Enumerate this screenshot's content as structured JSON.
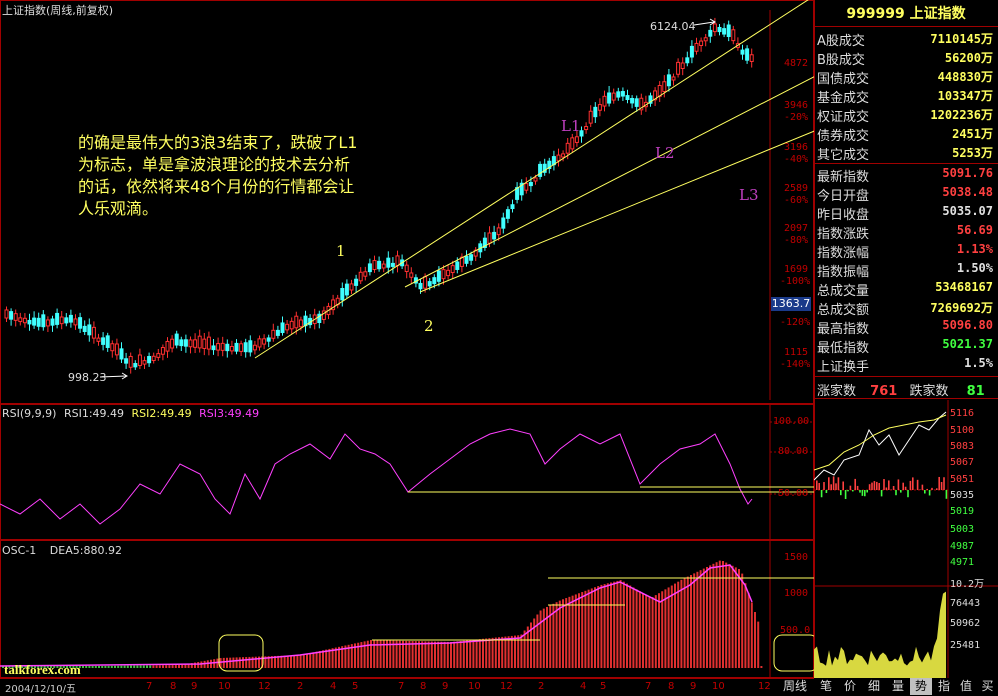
{
  "main_chart": {
    "title": "上证指数(周线,前复权)",
    "high_label": "6124.04",
    "low_label": "998.23",
    "current_price_box": "1363.7",
    "wave_labels": [
      "1",
      "2",
      "L1",
      "L2",
      "L3"
    ],
    "annotation": [
      "的确是最伟大的3浪3结束了，跌破了L1",
      "为标志，单是拿波浪理论的技术去分析",
      "的话，依然将来48个月份的行情都会让",
      "人乐观滴。"
    ],
    "y_axis": [
      {
        "label": "4872",
        "pct": ""
      },
      {
        "label": "3946",
        "pct": "-20%"
      },
      {
        "label": "3196",
        "pct": "-40%"
      },
      {
        "label": "2589",
        "pct": "-60%"
      },
      {
        "label": "2097",
        "pct": "-80%"
      },
      {
        "label": "1699",
        "pct": "-100%"
      },
      {
        "label": "",
        "pct": "-120%"
      },
      {
        "label": "1115",
        "pct": "-140%"
      }
    ],
    "colors": {
      "up": "#ff3030",
      "down": "#40ffff",
      "trend": "#ffff60",
      "wave_label": "#c040c0"
    }
  },
  "rsi_panel": {
    "title": "RSI(9,9,9)",
    "rsi1": "RSI1:49.49",
    "rsi2": "RSI2:49.49",
    "rsi3": "RSI3:49.49",
    "y_axis": [
      "100.00",
      "80.00",
      "50.00"
    ]
  },
  "osc_panel": {
    "title": "OSC-1",
    "dea": "DEA5:880.92",
    "y_axis": [
      "1500",
      "1000",
      "500.0"
    ]
  },
  "time_axis": [
    "7",
    "8",
    "9",
    "10",
    "12",
    "2",
    "4",
    "5",
    "7",
    "8",
    "9",
    "10",
    "12",
    "2",
    "4",
    "5",
    "7",
    "8",
    "9",
    "10",
    "12"
  ],
  "time_axis_date": "2004/12/10/五",
  "watermark": "talkforex.com",
  "right_panel": {
    "header": "999999 上证指数",
    "volumes": [
      {
        "label": "A股成交",
        "value": "7110145万"
      },
      {
        "label": "B股成交",
        "value": "56200万"
      },
      {
        "label": "国债成交",
        "value": "448830万"
      },
      {
        "label": "基金成交",
        "value": "103347万"
      },
      {
        "label": "权证成交",
        "value": "1202236万"
      },
      {
        "label": "债券成交",
        "value": "2451万"
      },
      {
        "label": "其它成交",
        "value": "5253万"
      }
    ],
    "quotes": [
      {
        "label": "最新指数",
        "value": "5091.76",
        "color": "#ff4040"
      },
      {
        "label": "今日开盘",
        "value": "5038.48",
        "color": "#ff4040"
      },
      {
        "label": "昨日收盘",
        "value": "5035.07",
        "color": "#e0e0e0"
      },
      {
        "label": "指数涨跌",
        "value": "56.69",
        "color": "#ff4040"
      },
      {
        "label": "指数涨幅",
        "value": "1.13%",
        "color": "#ff4040"
      },
      {
        "label": "指数振幅",
        "value": "1.50%",
        "color": "#e0e0e0"
      },
      {
        "label": "总成交量",
        "value": "53468167",
        "color": "#ffff60"
      },
      {
        "label": "总成交额",
        "value": "7269692万",
        "color": "#ffff60"
      },
      {
        "label": "最高指数",
        "value": "5096.80",
        "color": "#ff4040"
      },
      {
        "label": "最低指数",
        "value": "5021.37",
        "color": "#40ff40"
      },
      {
        "label": "上证换手",
        "value": "1.5%",
        "color": "#e0e0e0"
      }
    ],
    "advance_label": "涨家数",
    "advance_value": "761",
    "decline_label": "跌家数",
    "decline_value": "81",
    "intraday_axis": [
      "5116",
      "5100",
      "5083",
      "5067",
      "5051",
      "5035",
      "5019",
      "5003",
      "4987",
      "4971",
      "10.2万"
    ],
    "volume_axis": [
      "76443",
      "50962",
      "25481"
    ]
  },
  "tabs": [
    "周线",
    "笔",
    "价",
    "细",
    "量",
    "势",
    "指",
    "值",
    "买"
  ],
  "active_tab": "势"
}
